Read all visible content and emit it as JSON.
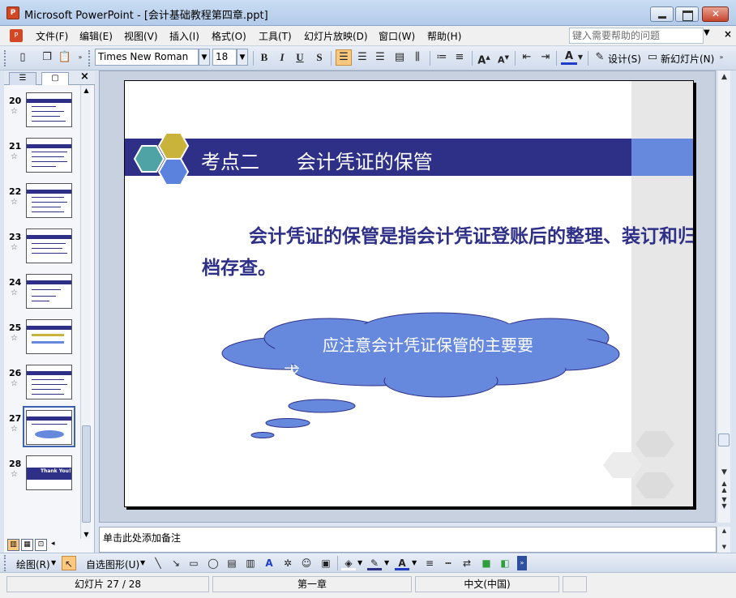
{
  "window": {
    "title": "Microsoft PowerPoint - [会计基础教程第四章.ppt]"
  },
  "menubar": {
    "items": [
      "文件(F)",
      "编辑(E)",
      "视图(V)",
      "插入(I)",
      "格式(O)",
      "工具(T)",
      "幻灯片放映(D)",
      "窗口(W)",
      "帮助(H)"
    ],
    "help_placeholder": "键入需要帮助的问题"
  },
  "toolbar": {
    "font_name": "Times New Roman",
    "font_size": "18",
    "design_label": "设计(S)",
    "new_slide_label": "新幻灯片(N)"
  },
  "slides_panel": {
    "thumbnails": [
      {
        "num": "20"
      },
      {
        "num": "21"
      },
      {
        "num": "22"
      },
      {
        "num": "23"
      },
      {
        "num": "24"
      },
      {
        "num": "25"
      },
      {
        "num": "26"
      },
      {
        "num": "27"
      },
      {
        "num": "28"
      }
    ],
    "thumb_28_text": "Thank You!"
  },
  "slide": {
    "title": "考点二      会计凭证的保管",
    "body": "会计凭证的保管是指会计凭证登账后的整理、装订和归档存查。",
    "cloud_text": "应注意会计凭证保管的主要要求",
    "colors": {
      "band": "#2e2f87",
      "band_accent": "#6789dd",
      "cloud": "#6789dd",
      "hex_teal": "#4fa3a5",
      "hex_gold": "#c9b33b",
      "hex_blue": "#5b82dc"
    }
  },
  "notes": {
    "placeholder": "单击此处添加备注"
  },
  "drawbar": {
    "draw_label": "绘图(R)",
    "autoshape_label": "自选图形(U)"
  },
  "statusbar": {
    "slide_info": "幻灯片 27 / 28",
    "design_name": "第一章",
    "language": "中文(中国)"
  }
}
